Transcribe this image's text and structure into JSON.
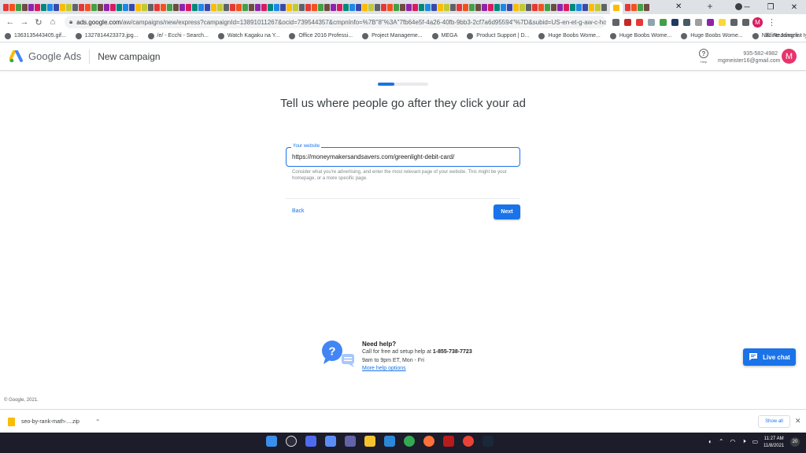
{
  "browser": {
    "active_tab_title": "",
    "new_tab_glyph": "+",
    "omnibox": {
      "host": "ads.google.com",
      "path": "/aw/campaigns/new/express?campaignId=13891011267&ocid=739544357&cmpnInfo=%7B\"8\"%3A\"7fb64e5f-4a26-40fb-9bb3-2cf7a6d95594\"%7D&subid=US-en-et-g-aw-c-home..."
    },
    "avatar_letter": "M",
    "bookmarks": [
      {
        "label": "1363135443405.gif..."
      },
      {
        "label": "1327814423373.jpg..."
      },
      {
        "label": "/e/ - Ecchi - Search..."
      },
      {
        "label": "Watch Kagaku na Y..."
      },
      {
        "label": "Office 2016 Professi..."
      },
      {
        "label": "Project Manageme..."
      },
      {
        "label": "MEGA"
      },
      {
        "label": "Product Support | D..."
      },
      {
        "label": "Huge Boobs Wome..."
      },
      {
        "label": "Huge Boobs Wome..."
      },
      {
        "label": "Huge Boobs Wome..."
      },
      {
        "label": "Nadine Jansen - Iyi..."
      }
    ],
    "bookmarks_more": "»",
    "reading_list": "Reading list"
  },
  "ads_header": {
    "brand": "Google Ads",
    "title": "New campaign",
    "help_label": "Help",
    "phone": "935-582-4982",
    "email": "mgmeister16@gmail.com",
    "avatar_letter": "M"
  },
  "step": {
    "progress_fraction": 0.33,
    "heading": "Tell us where people go after they click your ad",
    "field_label": "Your website",
    "field_value": "https://moneymakersandsavers.com/greenlight-debit-card/",
    "helper_text": "Consider what you're advertising, and enter the most relevant page of your website. This might be your homepage, or a more specific page.",
    "back_label": "Back",
    "next_label": "Next"
  },
  "need_help": {
    "title": "Need help?",
    "call_prefix": "Call for free ad setup help at ",
    "phone": "1-855-738-7723",
    "hours": "9am to 9pm ET, Mon - Fri",
    "more_link": "More help options"
  },
  "live_chat": "Live chat",
  "footer": "© Google, 2021.",
  "download_bar": {
    "file_name": "seo-by-rank-math-....zip",
    "show_all": "Show all"
  },
  "taskbar": {
    "time": "11:27 AM",
    "date": "11/8/2021",
    "notification_count": "20"
  },
  "colors": {
    "accent": "#1a73e8",
    "avatar": "#e8336b"
  }
}
